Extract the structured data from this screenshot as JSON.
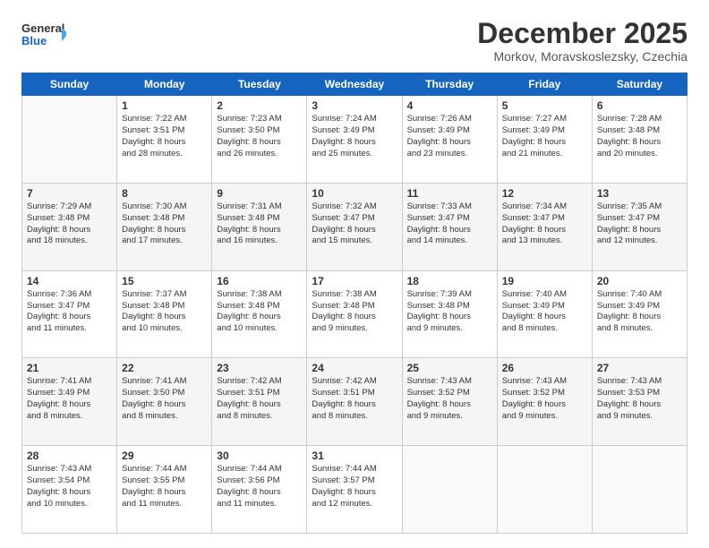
{
  "logo": {
    "line1": "General",
    "line2": "Blue"
  },
  "title": "December 2025",
  "subtitle": "Morkov, Moravskoslezsky, Czechia",
  "days_header": [
    "Sunday",
    "Monday",
    "Tuesday",
    "Wednesday",
    "Thursday",
    "Friday",
    "Saturday"
  ],
  "weeks": [
    [
      {
        "day": "",
        "info": ""
      },
      {
        "day": "1",
        "info": "Sunrise: 7:22 AM\nSunset: 3:51 PM\nDaylight: 8 hours\nand 28 minutes."
      },
      {
        "day": "2",
        "info": "Sunrise: 7:23 AM\nSunset: 3:50 PM\nDaylight: 8 hours\nand 26 minutes."
      },
      {
        "day": "3",
        "info": "Sunrise: 7:24 AM\nSunset: 3:49 PM\nDaylight: 8 hours\nand 25 minutes."
      },
      {
        "day": "4",
        "info": "Sunrise: 7:26 AM\nSunset: 3:49 PM\nDaylight: 8 hours\nand 23 minutes."
      },
      {
        "day": "5",
        "info": "Sunrise: 7:27 AM\nSunset: 3:49 PM\nDaylight: 8 hours\nand 21 minutes."
      },
      {
        "day": "6",
        "info": "Sunrise: 7:28 AM\nSunset: 3:48 PM\nDaylight: 8 hours\nand 20 minutes."
      }
    ],
    [
      {
        "day": "7",
        "info": "Sunrise: 7:29 AM\nSunset: 3:48 PM\nDaylight: 8 hours\nand 18 minutes."
      },
      {
        "day": "8",
        "info": "Sunrise: 7:30 AM\nSunset: 3:48 PM\nDaylight: 8 hours\nand 17 minutes."
      },
      {
        "day": "9",
        "info": "Sunrise: 7:31 AM\nSunset: 3:48 PM\nDaylight: 8 hours\nand 16 minutes."
      },
      {
        "day": "10",
        "info": "Sunrise: 7:32 AM\nSunset: 3:47 PM\nDaylight: 8 hours\nand 15 minutes."
      },
      {
        "day": "11",
        "info": "Sunrise: 7:33 AM\nSunset: 3:47 PM\nDaylight: 8 hours\nand 14 minutes."
      },
      {
        "day": "12",
        "info": "Sunrise: 7:34 AM\nSunset: 3:47 PM\nDaylight: 8 hours\nand 13 minutes."
      },
      {
        "day": "13",
        "info": "Sunrise: 7:35 AM\nSunset: 3:47 PM\nDaylight: 8 hours\nand 12 minutes."
      }
    ],
    [
      {
        "day": "14",
        "info": "Sunrise: 7:36 AM\nSunset: 3:47 PM\nDaylight: 8 hours\nand 11 minutes."
      },
      {
        "day": "15",
        "info": "Sunrise: 7:37 AM\nSunset: 3:48 PM\nDaylight: 8 hours\nand 10 minutes."
      },
      {
        "day": "16",
        "info": "Sunrise: 7:38 AM\nSunset: 3:48 PM\nDaylight: 8 hours\nand 10 minutes."
      },
      {
        "day": "17",
        "info": "Sunrise: 7:38 AM\nSunset: 3:48 PM\nDaylight: 8 hours\nand 9 minutes."
      },
      {
        "day": "18",
        "info": "Sunrise: 7:39 AM\nSunset: 3:48 PM\nDaylight: 8 hours\nand 9 minutes."
      },
      {
        "day": "19",
        "info": "Sunrise: 7:40 AM\nSunset: 3:49 PM\nDaylight: 8 hours\nand 8 minutes."
      },
      {
        "day": "20",
        "info": "Sunrise: 7:40 AM\nSunset: 3:49 PM\nDaylight: 8 hours\nand 8 minutes."
      }
    ],
    [
      {
        "day": "21",
        "info": "Sunrise: 7:41 AM\nSunset: 3:49 PM\nDaylight: 8 hours\nand 8 minutes."
      },
      {
        "day": "22",
        "info": "Sunrise: 7:41 AM\nSunset: 3:50 PM\nDaylight: 8 hours\nand 8 minutes."
      },
      {
        "day": "23",
        "info": "Sunrise: 7:42 AM\nSunset: 3:51 PM\nDaylight: 8 hours\nand 8 minutes."
      },
      {
        "day": "24",
        "info": "Sunrise: 7:42 AM\nSunset: 3:51 PM\nDaylight: 8 hours\nand 8 minutes."
      },
      {
        "day": "25",
        "info": "Sunrise: 7:43 AM\nSunset: 3:52 PM\nDaylight: 8 hours\nand 9 minutes."
      },
      {
        "day": "26",
        "info": "Sunrise: 7:43 AM\nSunset: 3:52 PM\nDaylight: 8 hours\nand 9 minutes."
      },
      {
        "day": "27",
        "info": "Sunrise: 7:43 AM\nSunset: 3:53 PM\nDaylight: 8 hours\nand 9 minutes."
      }
    ],
    [
      {
        "day": "28",
        "info": "Sunrise: 7:43 AM\nSunset: 3:54 PM\nDaylight: 8 hours\nand 10 minutes."
      },
      {
        "day": "29",
        "info": "Sunrise: 7:44 AM\nSunset: 3:55 PM\nDaylight: 8 hours\nand 11 minutes."
      },
      {
        "day": "30",
        "info": "Sunrise: 7:44 AM\nSunset: 3:56 PM\nDaylight: 8 hours\nand 11 minutes."
      },
      {
        "day": "31",
        "info": "Sunrise: 7:44 AM\nSunset: 3:57 PM\nDaylight: 8 hours\nand 12 minutes."
      },
      {
        "day": "",
        "info": ""
      },
      {
        "day": "",
        "info": ""
      },
      {
        "day": "",
        "info": ""
      }
    ]
  ]
}
